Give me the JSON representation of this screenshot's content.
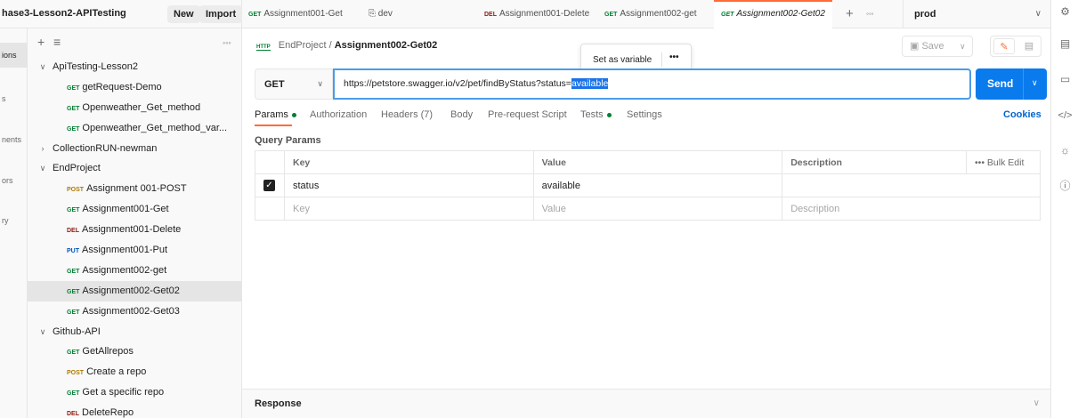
{
  "workspace": {
    "name": "hase3-Lesson2-APITesting",
    "new_label": "New",
    "import_label": "Import"
  },
  "rail": {
    "items": [
      "ions",
      "s",
      "nents",
      "ors",
      "ry"
    ]
  },
  "sidebar": {
    "items": [
      {
        "type": "folder",
        "label": "ApiTesting-Lesson2",
        "expanded": true,
        "depth": 0
      },
      {
        "type": "request",
        "method": "GET",
        "label": "getRequest-Demo",
        "depth": 1
      },
      {
        "type": "request",
        "method": "GET",
        "label": "Openweather_Get_method",
        "depth": 1
      },
      {
        "type": "request",
        "method": "GET",
        "label": "Openweather_Get_method_var...",
        "depth": 1
      },
      {
        "type": "folder",
        "label": "CollectionRUN-newman",
        "expanded": false,
        "depth": 0
      },
      {
        "type": "folder",
        "label": "EndProject",
        "expanded": true,
        "depth": 0
      },
      {
        "type": "request",
        "method": "POST",
        "label": "Assignment 001-POST",
        "depth": 1
      },
      {
        "type": "request",
        "method": "GET",
        "label": "Assignment001-Get",
        "depth": 1
      },
      {
        "type": "request",
        "method": "DEL",
        "label": "Assignment001-Delete",
        "depth": 1
      },
      {
        "type": "request",
        "method": "PUT",
        "label": "Assignment001-Put",
        "depth": 1
      },
      {
        "type": "request",
        "method": "GET",
        "label": "Assignment002-get",
        "depth": 1
      },
      {
        "type": "request",
        "method": "GET",
        "label": "Assignment002-Get02",
        "depth": 1,
        "selected": true
      },
      {
        "type": "request",
        "method": "GET",
        "label": "Assignment002-Get03",
        "depth": 1
      },
      {
        "type": "folder",
        "label": "Github-API",
        "expanded": true,
        "depth": 0
      },
      {
        "type": "request",
        "method": "GET",
        "label": "GetAllrepos",
        "depth": 1
      },
      {
        "type": "request",
        "method": "POST",
        "label": "Create a repo",
        "depth": 1
      },
      {
        "type": "request",
        "method": "GET",
        "label": "Get a specific repo",
        "depth": 1
      },
      {
        "type": "request",
        "method": "DEL",
        "label": "DeleteRepo",
        "depth": 1
      }
    ]
  },
  "tabs": [
    {
      "method": "GET",
      "label": "Assignment001-Get"
    },
    {
      "method": "",
      "label": "dev",
      "icon": "environment-icon"
    },
    {
      "method": "DEL",
      "label": "Assignment001-Delete"
    },
    {
      "method": "GET",
      "label": "Assignment002-get"
    },
    {
      "method": "GET",
      "label": "Assignment002-Get02",
      "active": true
    }
  ],
  "environment": {
    "selected": "prod"
  },
  "request": {
    "collection": "EndProject",
    "separator": "/",
    "name": "Assignment002-Get02",
    "http_badge": "HTTP",
    "save_label": "Save",
    "method": "GET",
    "url_prefix": "https://petstore.swagger.io/v2/pet/findByStatus?status=",
    "url_selected": "available",
    "send_label": "Send",
    "popover_label": "Set as variable",
    "popover_more": "•••"
  },
  "request_tabs": [
    {
      "label": "Params",
      "dot": true,
      "active": true
    },
    {
      "label": "Authorization",
      "dot": false
    },
    {
      "label": "Headers (7)",
      "dot": false
    },
    {
      "label": "Body",
      "dot": false
    },
    {
      "label": "Pre-request Script",
      "dot": false
    },
    {
      "label": "Tests",
      "dot": true
    },
    {
      "label": "Settings",
      "dot": false
    }
  ],
  "cookies_label": "Cookies",
  "query_params": {
    "title": "Query Params",
    "headers": {
      "key": "Key",
      "value": "Value",
      "description": "Description",
      "bulk_edit": "Bulk Edit",
      "more": "•••"
    },
    "rows": [
      {
        "checked": true,
        "key": "status",
        "value": "available",
        "description": ""
      }
    ],
    "placeholder": {
      "key": "Key",
      "value": "Value",
      "description": "Description"
    }
  },
  "response": {
    "label": "Response"
  },
  "colors": {
    "accent": "#ff6c37",
    "send": "#097bed",
    "get": "#007f31",
    "post": "#ad7a03",
    "put": "#0053b8",
    "del": "#8e1a10"
  }
}
